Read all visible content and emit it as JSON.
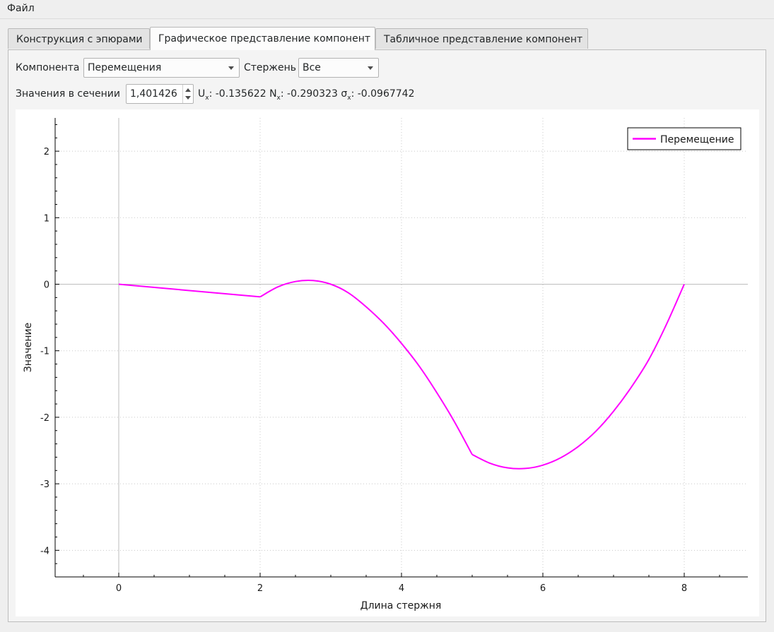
{
  "menu": {
    "file": "Файл"
  },
  "tabs": [
    "Конструкция с эпюрами",
    "Графическое представление компонент",
    "Табличное представление компонент"
  ],
  "controls": {
    "component_label": "Компонента",
    "component_value": "Перемещения",
    "rod_label": "Стержень",
    "rod_value": "Все",
    "section_label": "Значения в сечении",
    "section_value": "1,401426",
    "ux_label": "U",
    "ux_sub": "x",
    "ux_value": ": -0.135622",
    "nx_label": "N",
    "nx_sub": "x",
    "nx_value": ": -0.290323",
    "sx_label": "σ",
    "sx_sub": "x",
    "sx_value": ": -0.0967742"
  },
  "chart_data": {
    "type": "line",
    "xlabel": "Длина стержня",
    "ylabel": "Значение",
    "xlim": [
      -0.9,
      8.9
    ],
    "ylim": [
      -4.4,
      2.5
    ],
    "xticks": [
      0,
      2,
      4,
      6,
      8
    ],
    "yticks": [
      -4,
      -3,
      -2,
      -1,
      0,
      1,
      2
    ],
    "grid": true,
    "legend_position": "top-right",
    "series": [
      {
        "name": "Перемещение",
        "color": "#ff00ff",
        "x": [
          0,
          2,
          2.25,
          2.5,
          2.75,
          3,
          3.25,
          3.5,
          3.75,
          4,
          4.25,
          4.5,
          4.75,
          5,
          5.25,
          5.5,
          5.75,
          6,
          6.25,
          6.5,
          6.75,
          7,
          7.25,
          7.5,
          7.75,
          8
        ],
        "y": [
          0,
          -0.19,
          -0.04,
          0.04,
          0.055,
          0.0,
          -0.13,
          -0.34,
          -0.59,
          -0.89,
          -1.23,
          -1.63,
          -2.07,
          -2.56,
          -2.69,
          -2.76,
          -2.77,
          -2.72,
          -2.61,
          -2.44,
          -2.21,
          -1.91,
          -1.55,
          -1.13,
          -0.6,
          0
        ]
      }
    ]
  }
}
